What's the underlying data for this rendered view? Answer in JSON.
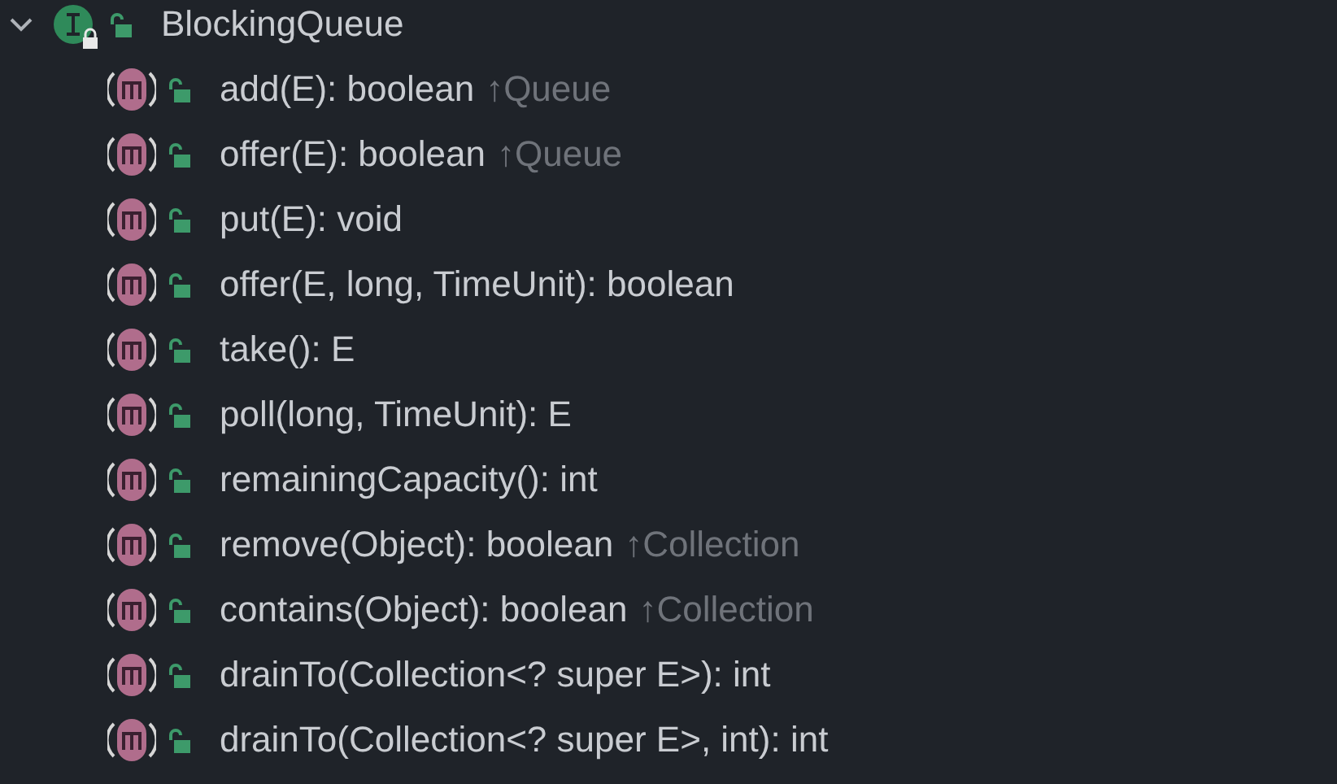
{
  "tree": {
    "label": "BlockingQueue",
    "expanded": true,
    "children": [
      {
        "label": "add(E): boolean",
        "inherited_from": "↑Queue"
      },
      {
        "label": "offer(E): boolean",
        "inherited_from": "↑Queue"
      },
      {
        "label": "put(E): void"
      },
      {
        "label": "offer(E, long, TimeUnit): boolean"
      },
      {
        "label": "take(): E"
      },
      {
        "label": "poll(long, TimeUnit): E"
      },
      {
        "label": "remainingCapacity(): int"
      },
      {
        "label": "remove(Object): boolean",
        "inherited_from": "↑Collection"
      },
      {
        "label": "contains(Object): boolean",
        "inherited_from": "↑Collection"
      },
      {
        "label": "drainTo(Collection<? super E>): int"
      },
      {
        "label": "drainTo(Collection<? super E>, int): int"
      }
    ]
  }
}
